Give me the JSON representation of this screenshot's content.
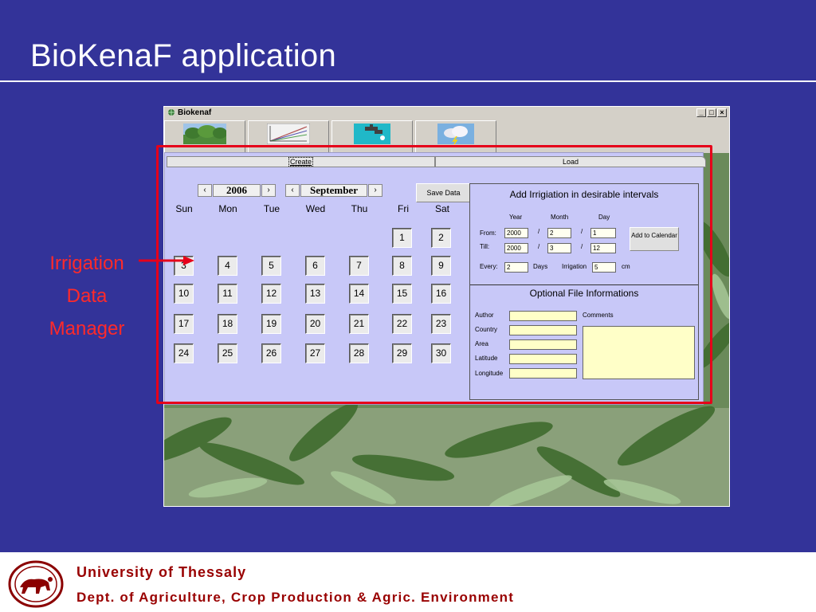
{
  "slide": {
    "title": "BioKenaF application",
    "callout_lines": [
      "Irrigation",
      "Data",
      "Manager"
    ],
    "footer_university": "University of Thessaly",
    "footer_department": "Dept. of Agriculture, Crop Production & Agric. Environment"
  },
  "colors": {
    "slide_background": "#333399",
    "panel_background": "#c8c8f8",
    "highlight_border": "#e6001a",
    "callout_text": "#ff2a2a",
    "footer_text": "#990000"
  },
  "window": {
    "title": "Biokenaf",
    "icon": "app-icon",
    "controls": [
      "_",
      "□",
      "×"
    ],
    "toolbar": [
      {
        "name": "crop-conditions-button",
        "icon": "crop-field-image"
      },
      {
        "name": "n-conditions-button",
        "icon": "growth-chart-image"
      },
      {
        "name": "irrigation-data-button",
        "icon": "water-tap-image"
      },
      {
        "name": "meteorological-data-button",
        "icon": "weather-cloud-image"
      }
    ],
    "tabs": {
      "create": "Create",
      "load": "Load"
    }
  },
  "calendar": {
    "year": "2006",
    "month": "September",
    "prev_symbol": "‹",
    "next_symbol": "›",
    "save_label": "Save Data",
    "weekdays": [
      "Sun",
      "Mon",
      "Tue",
      "Wed",
      "Thu",
      "Fri",
      "Sat"
    ],
    "days": [
      "1",
      "2",
      "3",
      "4",
      "5",
      "6",
      "7",
      "8",
      "9",
      "10",
      "11",
      "12",
      "13",
      "14",
      "15",
      "16",
      "17",
      "18",
      "19",
      "20",
      "21",
      "22",
      "23",
      "24",
      "25",
      "26",
      "27",
      "28",
      "29",
      "30"
    ]
  },
  "irrigation": {
    "title": "Add Irrigiation in desirable intervals",
    "col_year": "Year",
    "col_month": "Month",
    "col_day": "Day",
    "from_label": "From:",
    "till_label": "Till:",
    "from_year": "2000",
    "from_month": "2",
    "from_day": "1",
    "till_year": "2000",
    "till_month": "3",
    "till_day": "12",
    "slash": "/",
    "every_label": "Every:",
    "every_value": "2",
    "days_label": "Days",
    "irrigation_label": "Irrigation",
    "irrigation_value": "5",
    "unit": "cm",
    "add_button": "Add to Calendar"
  },
  "file_info": {
    "title": "Optional File Informations",
    "author_label": "Author",
    "country_label": "Country",
    "area_label": "Area",
    "latitude_label": "Latitude",
    "longitude_label": "Longitude",
    "comments_label": "Comments"
  }
}
